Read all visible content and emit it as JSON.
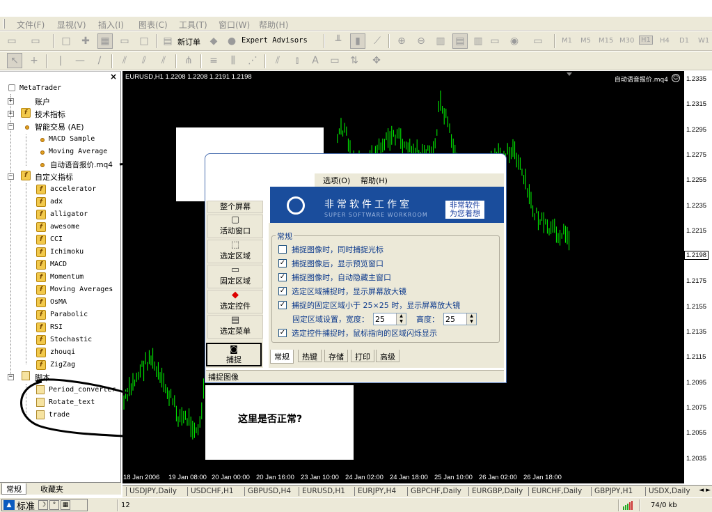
{
  "menu": [
    "文件(F)",
    "显视(V)",
    "插入(I)",
    "图表(C)",
    "工具(T)",
    "窗口(W)",
    "帮助(H)"
  ],
  "toolbar": {
    "new_order": "新订单",
    "expert_advisors": "Expert Advisors",
    "timeframes": [
      "M1",
      "M5",
      "M15",
      "M30",
      "H1",
      "H4",
      "D1",
      "W1"
    ],
    "active_timeframe": "H1",
    "text_tool": "A"
  },
  "navigator": {
    "root": "MetaTrader",
    "accounts": "账户",
    "indicators": "技术指标",
    "experts": "智能交易 (AE)",
    "experts_items": [
      "MACD Sample",
      "Moving Average",
      "自动语音报价.mq4"
    ],
    "custom": "自定义指标",
    "custom_items": [
      "accelerator",
      "adx",
      "alligator",
      "awesome",
      "CCI",
      "Ichimoku",
      "MACD",
      "Momentum",
      "Moving Averages",
      "OsMA",
      "Parabolic",
      "RSI",
      "Stochastic",
      "zhouqi",
      "ZigZag"
    ],
    "scripts": "脚本",
    "scripts_items": [
      "Period_converter",
      "Rotate_text",
      "trade"
    ],
    "tabs": [
      "常规",
      "收藏夹"
    ],
    "close": "×"
  },
  "chart": {
    "info": "EURUSD,H1  1.2208 1.2208 1.2191 1.2198",
    "ea_label": "自动语音报价.mq4",
    "ea_face": "☺",
    "current_price": "1.2198",
    "price_labels": [
      "1.2335",
      "1.2315",
      "1.2295",
      "1.2275",
      "1.2255",
      "1.2235",
      "1.2215",
      "1.2195",
      "1.2175",
      "1.2155",
      "1.2135",
      "1.2115",
      "1.2095",
      "1.2075",
      "1.2055",
      "1.2035"
    ],
    "time_labels": [
      "18 Jan 2006",
      "19 Jan 08:00",
      "20 Jan 00:00",
      "20 Jan 16:00",
      "23 Jan 10:00",
      "24 Jan 02:00",
      "24 Jan 18:00",
      "25 Jan 10:00",
      "26 Jan 02:00",
      "26 Jan 18:00"
    ],
    "colors": {
      "background": "#000000",
      "candle": "#00ff00"
    }
  },
  "chart_tabs": [
    "USDJPY,Daily",
    "USDCHF,H1",
    "GBPUSD,H4",
    "EURUSD,H1",
    "EURJPY,H4",
    "GBPCHF,Daily",
    "EURGBP,Daily",
    "EURCHF,Daily",
    "GBPJPY,H1",
    "USDX,Daily"
  ],
  "tab_arrows": "◄ ►",
  "status": {
    "ime_label": "标准",
    "left_value": "12",
    "traffic": "74/0 kb"
  },
  "dialog": {
    "menu": [
      "选项(O)",
      "帮助(H)"
    ],
    "brand": "非常软件工作室",
    "brand_en": "SUPER SOFTWARE WORKROOM",
    "slogan_lines": [
      "非常软件",
      "为您着想"
    ],
    "left_buttons": [
      "整个屏幕",
      "活动窗口",
      "选定区域",
      "固定区域",
      "选定控件",
      "选定菜单"
    ],
    "capture": "捕捉",
    "group_title": "常规",
    "options": [
      {
        "label": "捕捉图像时，同时捕捉光标",
        "checked": false
      },
      {
        "label": "捕捉图像后，显示预览窗口",
        "checked": true
      },
      {
        "label": "捕捉图像时，自动隐藏主窗口",
        "checked": true
      },
      {
        "label": "选定区域捕捉时，显示屏幕放大镜",
        "checked": true
      },
      {
        "label": "捕捉的固定区域小于 25×25 时，显示屏幕放大镜",
        "checked": true
      }
    ],
    "fixed_area": {
      "label": "固定区域设置，宽度：",
      "width": "25",
      "height_label": "高度：",
      "height": "25"
    },
    "last_option": {
      "label": "选定控件捕捉时，鼠标指向的区域闪烁显示",
      "checked": true
    },
    "tabs": [
      "常规",
      "热键",
      "存储",
      "打印",
      "高级"
    ],
    "status": "捕捉图像"
  },
  "annotation": "这里是否正常?"
}
